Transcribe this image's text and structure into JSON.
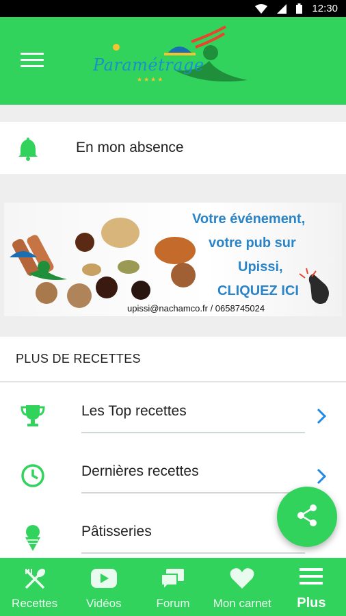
{
  "status_bar": {
    "time": "12:30"
  },
  "header": {
    "logo_text": "Paramétrage",
    "logo_stars": "★★★★"
  },
  "absence": {
    "label": "En mon absence"
  },
  "ad": {
    "line1": "Votre événement,",
    "line2": "votre pub sur",
    "line3": "Upissi,",
    "line4": "CLIQUEZ ICI",
    "contact": "upissi@nachamco.fr / 0658745024"
  },
  "section": {
    "title": "PLUS DE RECETTES"
  },
  "list": [
    {
      "label": "Les Top recettes",
      "icon": "trophy-icon"
    },
    {
      "label": "Dernières recettes",
      "icon": "clock-icon"
    },
    {
      "label": "Pâtisseries",
      "icon": "ice-cream-icon"
    }
  ],
  "bottom_nav": [
    {
      "label": "Recettes",
      "icon": "utensils-icon"
    },
    {
      "label": "Vidéos",
      "icon": "play-icon"
    },
    {
      "label": "Forum",
      "icon": "chat-icon"
    },
    {
      "label": "Mon carnet",
      "icon": "heart-icon"
    },
    {
      "label": "Plus",
      "icon": "menu-icon",
      "active": true
    }
  ],
  "colors": {
    "primary": "#31d35c",
    "chevron": "#1e88e5",
    "ad_text": "#2a84c7"
  }
}
